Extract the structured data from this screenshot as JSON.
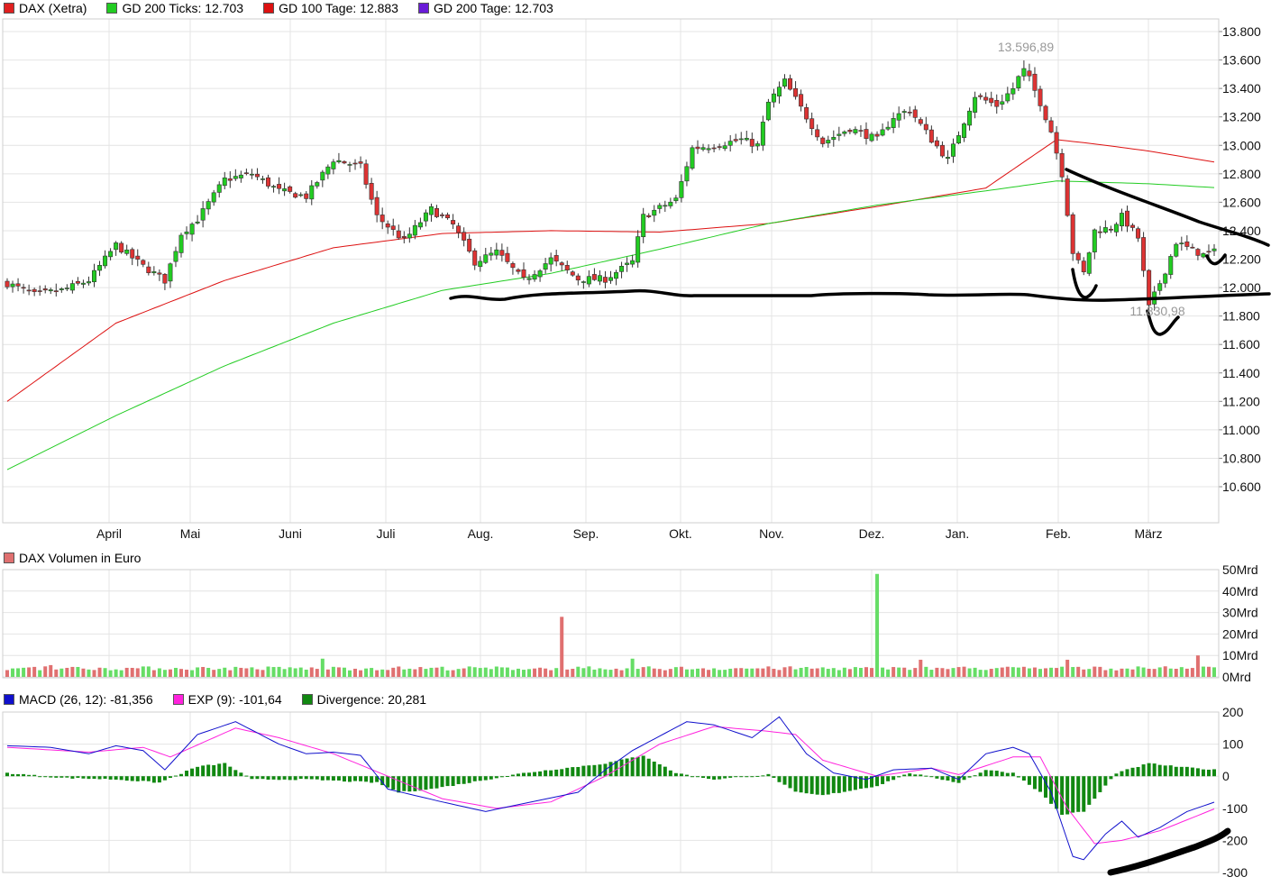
{
  "price_legend": [
    {
      "label": "DAX (Xetra)",
      "color": "#e02020"
    },
    {
      "label": "GD 200 Ticks: 12.703",
      "color": "#22cc22"
    },
    {
      "label": "GD 100 Tage: 12.883",
      "color": "#dd1111"
    },
    {
      "label": "GD 200 Tage: 12.703",
      "color": "#6a1bd8"
    }
  ],
  "volume_legend": [
    {
      "label": "DAX Volumen in Euro",
      "color": "#e07070"
    }
  ],
  "macd_legend": [
    {
      "label": "MACD (26, 12): -81,356",
      "color": "#1010cc"
    },
    {
      "label": "EXP (9): -101,64",
      "color": "#ff22dd"
    },
    {
      "label": "Divergence: 20,281",
      "color": "#118811"
    }
  ],
  "annotations": {
    "high": "13.596,89",
    "low": "11.830,98"
  },
  "colors": {
    "up": "#22cc22",
    "down": "#dd3333",
    "gd100": "#dd1111",
    "gd200": "#22cc22",
    "macd": "#1010cc",
    "exp": "#ff22dd",
    "divergence": "#118811",
    "grid": "#e4e4e4"
  },
  "chart_data": [
    {
      "type": "candlestick",
      "title": "DAX (Xetra)",
      "y_ticks": [
        "13.800",
        "13.600",
        "13.400",
        "13.200",
        "13.000",
        "12.800",
        "12.600",
        "12.400",
        "12.200",
        "12.000",
        "11.800",
        "11.600",
        "11.400",
        "11.200",
        "11.000",
        "10.800",
        "10.600"
      ],
      "x_labels": [
        "April",
        "Mai",
        "Juni",
        "Juli",
        "Aug.",
        "Sep.",
        "Okt.",
        "Nov.",
        "Dez.",
        "Jan.",
        "Feb.",
        "März"
      ],
      "ylim": [
        10300,
        13950
      ],
      "close_path": [
        [
          0,
          12030
        ],
        [
          5,
          11950
        ],
        [
          10,
          11980
        ],
        [
          15,
          12050
        ],
        [
          20,
          12300
        ],
        [
          25,
          12150
        ],
        [
          29,
          12050
        ],
        [
          32,
          12380
        ],
        [
          35,
          12480
        ],
        [
          40,
          12760
        ],
        [
          45,
          12800
        ],
        [
          50,
          12680
        ],
        [
          55,
          12640
        ],
        [
          60,
          12900
        ],
        [
          65,
          12850
        ],
        [
          68,
          12500
        ],
        [
          73,
          12330
        ],
        [
          78,
          12550
        ],
        [
          82,
          12440
        ],
        [
          86,
          12180
        ],
        [
          90,
          12250
        ],
        [
          95,
          12050
        ],
        [
          100,
          12200
        ],
        [
          105,
          12060
        ],
        [
          110,
          12060
        ],
        [
          115,
          12180
        ],
        [
          117,
          12500
        ],
        [
          120,
          12560
        ],
        [
          123,
          12620
        ],
        [
          126,
          12980
        ],
        [
          130,
          13000
        ],
        [
          135,
          13040
        ],
        [
          138,
          13000
        ],
        [
          140,
          13300
        ],
        [
          143,
          13450
        ],
        [
          147,
          13200
        ],
        [
          150,
          13020
        ],
        [
          155,
          13120
        ],
        [
          160,
          13040
        ],
        [
          163,
          13200
        ],
        [
          166,
          13250
        ],
        [
          170,
          13040
        ],
        [
          173,
          12900
        ],
        [
          175,
          13080
        ],
        [
          178,
          13350
        ],
        [
          182,
          13280
        ],
        [
          185,
          13400
        ],
        [
          187,
          13550
        ],
        [
          190,
          13300
        ],
        [
          192,
          13100
        ],
        [
          194,
          12800
        ],
        [
          196,
          12250
        ],
        [
          198,
          12100
        ],
        [
          200,
          12400
        ],
        [
          203,
          12420
        ],
        [
          205,
          12500
        ],
        [
          208,
          12350
        ],
        [
          210,
          11860
        ],
        [
          213,
          12120
        ],
        [
          215,
          12320
        ],
        [
          217,
          12280
        ],
        [
          220,
          12230
        ],
        [
          222,
          12250
        ]
      ],
      "gd100": [
        [
          0,
          11200
        ],
        [
          20,
          11750
        ],
        [
          40,
          12050
        ],
        [
          60,
          12280
        ],
        [
          80,
          12380
        ],
        [
          100,
          12400
        ],
        [
          120,
          12390
        ],
        [
          140,
          12450
        ],
        [
          160,
          12570
        ],
        [
          180,
          12700
        ],
        [
          193,
          13040
        ],
        [
          200,
          13010
        ],
        [
          210,
          12960
        ],
        [
          222,
          12883
        ]
      ],
      "gd200": [
        [
          0,
          10720
        ],
        [
          20,
          11100
        ],
        [
          40,
          11450
        ],
        [
          60,
          11750
        ],
        [
          80,
          11980
        ],
        [
          100,
          12100
        ],
        [
          120,
          12270
        ],
        [
          140,
          12450
        ],
        [
          160,
          12580
        ],
        [
          180,
          12680
        ],
        [
          193,
          12750
        ],
        [
          210,
          12730
        ],
        [
          222,
          12703
        ]
      ],
      "high": 13596.89,
      "low": 11830.98
    },
    {
      "type": "bar",
      "title": "DAX Volumen in Euro",
      "y_ticks": [
        "50Mrd",
        "40Mrd",
        "30Mrd",
        "20Mrd",
        "10Mrd",
        "0Mrd"
      ],
      "ylim": [
        0,
        50
      ],
      "typical_value": 3.8,
      "spikes": [
        [
          8,
          5.5
        ],
        [
          58,
          8.5
        ],
        [
          102,
          28
        ],
        [
          115,
          8.5
        ],
        [
          160,
          48
        ],
        [
          168,
          8
        ],
        [
          195,
          8
        ],
        [
          219,
          10
        ]
      ]
    },
    {
      "type": "line",
      "title": "MACD",
      "y_ticks": [
        "200",
        "100",
        "0",
        "-100",
        "-200",
        "-300"
      ],
      "ylim": [
        -300,
        200
      ],
      "series": [
        {
          "name": "MACD (26, 12)",
          "points": [
            [
              0,
              95
            ],
            [
              8,
              90
            ],
            [
              15,
              70
            ],
            [
              20,
              95
            ],
            [
              25,
              80
            ],
            [
              29,
              20
            ],
            [
              35,
              130
            ],
            [
              42,
              170
            ],
            [
              50,
              100
            ],
            [
              55,
              70
            ],
            [
              60,
              75
            ],
            [
              65,
              65
            ],
            [
              70,
              -40
            ],
            [
              80,
              -80
            ],
            [
              88,
              -110
            ],
            [
              95,
              -85
            ],
            [
              105,
              -50
            ],
            [
              110,
              20
            ],
            [
              115,
              80
            ],
            [
              125,
              170
            ],
            [
              130,
              160
            ],
            [
              137,
              120
            ],
            [
              142,
              185
            ],
            [
              147,
              70
            ],
            [
              152,
              10
            ],
            [
              158,
              -10
            ],
            [
              163,
              20
            ],
            [
              170,
              25
            ],
            [
              175,
              -10
            ],
            [
              180,
              70
            ],
            [
              185,
              90
            ],
            [
              188,
              70
            ],
            [
              192,
              -50
            ],
            [
              196,
              -250
            ],
            [
              198,
              -260
            ],
            [
              202,
              -180
            ],
            [
              205,
              -140
            ],
            [
              208,
              -190
            ],
            [
              212,
              -160
            ],
            [
              217,
              -110
            ],
            [
              222,
              -81
            ]
          ]
        },
        {
          "name": "EXP (9)",
          "points": [
            [
              0,
              90
            ],
            [
              15,
              75
            ],
            [
              25,
              90
            ],
            [
              30,
              60
            ],
            [
              42,
              150
            ],
            [
              50,
              120
            ],
            [
              60,
              70
            ],
            [
              70,
              0
            ],
            [
              80,
              -70
            ],
            [
              90,
              -100
            ],
            [
              100,
              -80
            ],
            [
              110,
              0
            ],
            [
              120,
              100
            ],
            [
              130,
              155
            ],
            [
              140,
              140
            ],
            [
              145,
              130
            ],
            [
              150,
              50
            ],
            [
              160,
              0
            ],
            [
              170,
              25
            ],
            [
              175,
              5
            ],
            [
              185,
              60
            ],
            [
              190,
              60
            ],
            [
              195,
              -100
            ],
            [
              200,
              -210
            ],
            [
              205,
              -200
            ],
            [
              212,
              -170
            ],
            [
              222,
              -102
            ]
          ]
        },
        {
          "name": "Divergence",
          "points": [
            [
              0,
              10
            ],
            [
              10,
              -5
            ],
            [
              20,
              -10
            ],
            [
              28,
              -20
            ],
            [
              35,
              30
            ],
            [
              40,
              40
            ],
            [
              45,
              -10
            ],
            [
              55,
              -10
            ],
            [
              68,
              -20
            ],
            [
              72,
              -50
            ],
            [
              78,
              -40
            ],
            [
              85,
              -20
            ],
            [
              95,
              10
            ],
            [
              110,
              40
            ],
            [
              117,
              65
            ],
            [
              123,
              10
            ],
            [
              130,
              -10
            ],
            [
              140,
              5
            ],
            [
              145,
              -50
            ],
            [
              150,
              -60
            ],
            [
              160,
              -30
            ],
            [
              166,
              10
            ],
            [
              175,
              -20
            ],
            [
              180,
              20
            ],
            [
              185,
              10
            ],
            [
              190,
              -50
            ],
            [
              194,
              -120
            ],
            [
              198,
              -110
            ],
            [
              204,
              10
            ],
            [
              210,
              40
            ],
            [
              215,
              30
            ],
            [
              222,
              20
            ]
          ]
        }
      ]
    }
  ]
}
